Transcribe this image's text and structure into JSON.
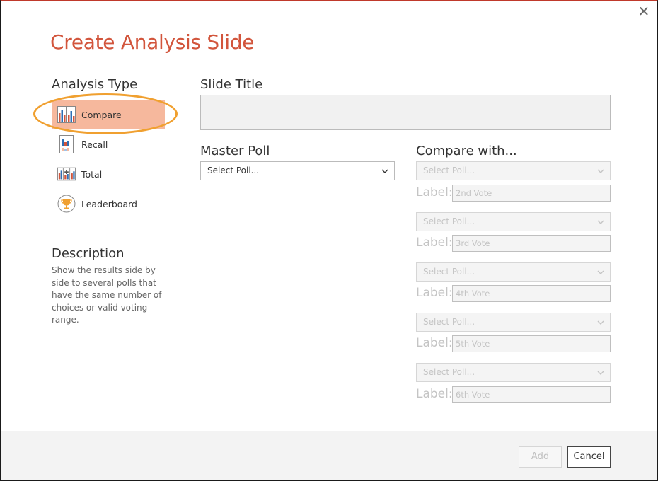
{
  "dialog": {
    "title": "Create Analysis Slide",
    "close_glyph": "✕"
  },
  "analysis_type": {
    "heading": "Analysis Type",
    "items": [
      {
        "label": "Compare",
        "icon": "compare-chart-icon",
        "active": true
      },
      {
        "label": "Recall",
        "icon": "recall-chart-icon",
        "active": false
      },
      {
        "label": "Total",
        "icon": "total-chart-icon",
        "active": false
      },
      {
        "label": "Leaderboard",
        "icon": "trophy-icon",
        "active": false
      }
    ]
  },
  "description": {
    "heading": "Description",
    "text": "Show the results side by side to several polls that have the same number of choices or valid voting range."
  },
  "slide_title": {
    "heading": "Slide Title",
    "value": ""
  },
  "master_poll": {
    "heading": "Master Poll",
    "selected": "Select Poll..."
  },
  "compare_with": {
    "heading": "Compare with...",
    "label_prefix": "Label:",
    "rows": [
      {
        "selected": "Select Poll...",
        "label_placeholder": "2nd Vote"
      },
      {
        "selected": "Select Poll...",
        "label_placeholder": "3rd Vote"
      },
      {
        "selected": "Select Poll...",
        "label_placeholder": "4th Vote"
      },
      {
        "selected": "Select Poll...",
        "label_placeholder": "5th Vote"
      },
      {
        "selected": "Select Poll...",
        "label_placeholder": "6th Vote"
      }
    ]
  },
  "footer": {
    "add_label": "Add",
    "cancel_label": "Cancel"
  },
  "colors": {
    "accent": "#d2553c",
    "active_item_bg": "#f6b89d",
    "highlight_ring": "#f0a030"
  }
}
